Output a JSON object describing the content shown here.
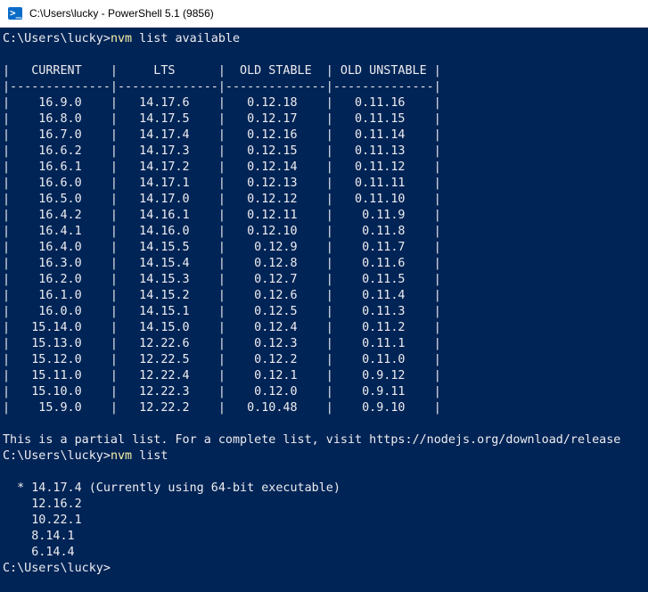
{
  "window": {
    "title": "C:\\Users\\lucky - PowerShell 5.1 (9856)",
    "icon": "powershell-icon"
  },
  "session": {
    "prompt1": "C:\\Users\\lucky>",
    "cmd1_name": "nvm",
    "cmd1_args": " list available",
    "table_header": "|   CURRENT    |     LTS      |  OLD STABLE  | OLD UNSTABLE |",
    "table_separator": "|--------------|--------------|--------------|--------------|",
    "table_rows": [
      "|    16.9.0    |   14.17.6    |   0.12.18    |   0.11.16    |",
      "|    16.8.0    |   14.17.5    |   0.12.17    |   0.11.15    |",
      "|    16.7.0    |   14.17.4    |   0.12.16    |   0.11.14    |",
      "|    16.6.2    |   14.17.3    |   0.12.15    |   0.11.13    |",
      "|    16.6.1    |   14.17.2    |   0.12.14    |   0.11.12    |",
      "|    16.6.0    |   14.17.1    |   0.12.13    |   0.11.11    |",
      "|    16.5.0    |   14.17.0    |   0.12.12    |   0.11.10    |",
      "|    16.4.2    |   14.16.1    |   0.12.11    |    0.11.9    |",
      "|    16.4.1    |   14.16.0    |   0.12.10    |    0.11.8    |",
      "|    16.4.0    |   14.15.5    |    0.12.9    |    0.11.7    |",
      "|    16.3.0    |   14.15.4    |    0.12.8    |    0.11.6    |",
      "|    16.2.0    |   14.15.3    |    0.12.7    |    0.11.5    |",
      "|    16.1.0    |   14.15.2    |    0.12.6    |    0.11.4    |",
      "|    16.0.0    |   14.15.1    |    0.12.5    |    0.11.3    |",
      "|   15.14.0    |   14.15.0    |    0.12.4    |    0.11.2    |",
      "|   15.13.0    |   12.22.6    |    0.12.3    |    0.11.1    |",
      "|   15.12.0    |   12.22.5    |    0.12.2    |    0.11.0    |",
      "|   15.11.0    |   12.22.4    |    0.12.1    |    0.9.12    |",
      "|   15.10.0    |   12.22.3    |    0.12.0    |    0.9.11    |",
      "|    15.9.0    |   12.22.2    |   0.10.48    |    0.9.10    |"
    ],
    "partial_notice": "This is a partial list. For a complete list, visit https://nodejs.org/download/release",
    "prompt2": "C:\\Users\\lucky>",
    "cmd2_name": "nvm",
    "cmd2_args": " list",
    "installed": [
      "  * 14.17.4 (Currently using 64-bit executable)",
      "    12.16.2",
      "    10.22.1",
      "    8.14.1",
      "    6.14.4"
    ],
    "prompt3": "C:\\Users\\lucky>"
  },
  "colors": {
    "background": "#012456",
    "text": "#eeedf0",
    "command": "#f9f1a5"
  }
}
